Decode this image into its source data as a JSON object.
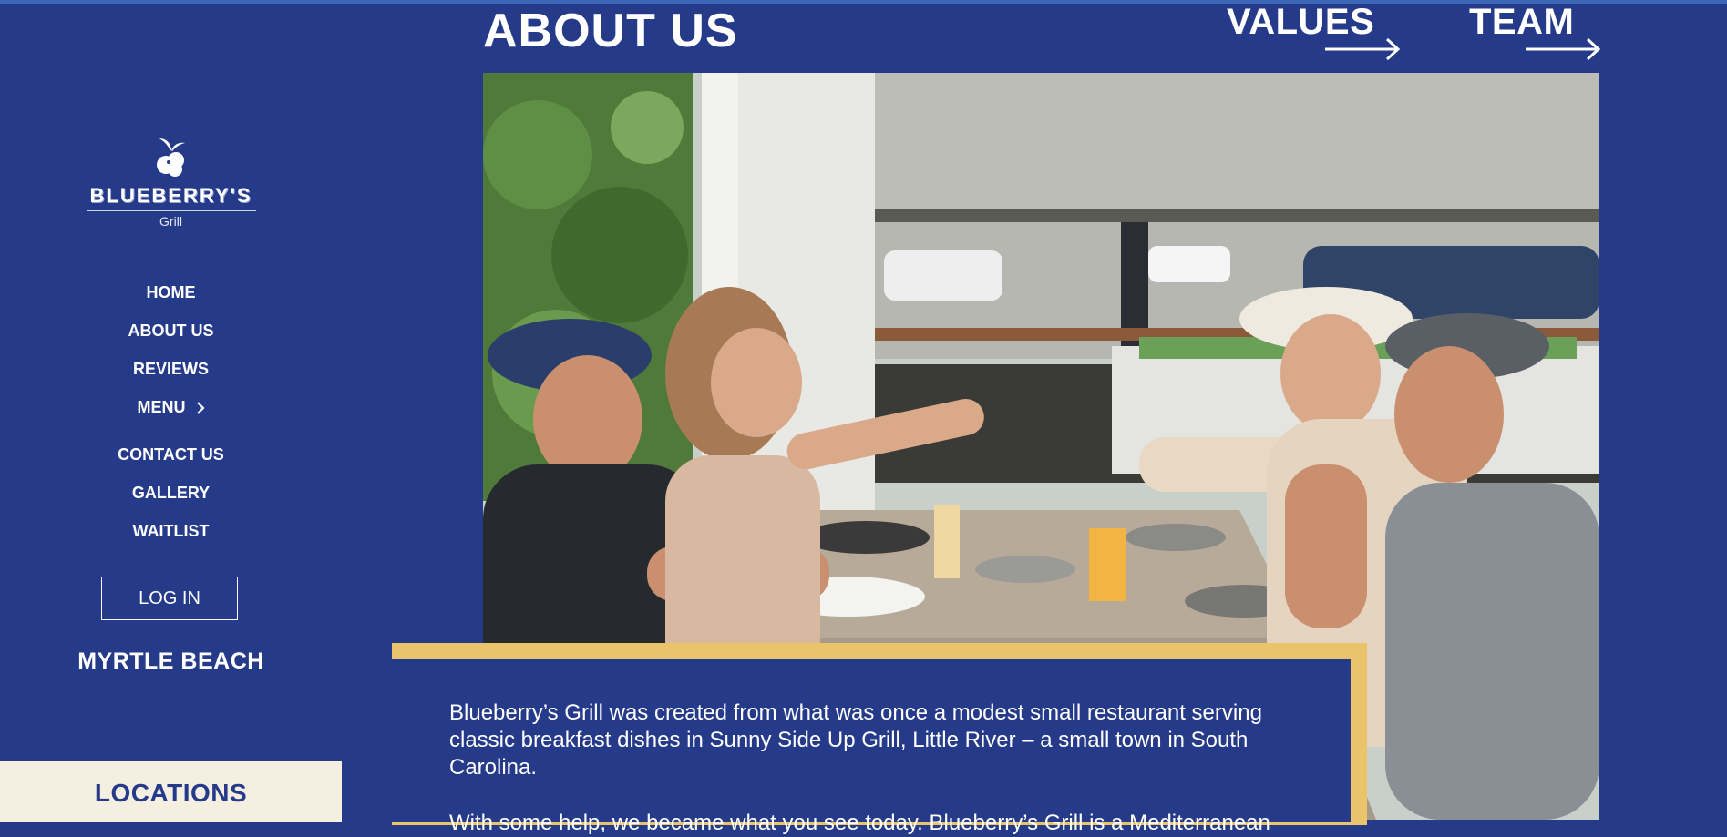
{
  "brand": {
    "name": "BLUEBERRY'S",
    "subtitle": "Grill"
  },
  "nav": {
    "items": [
      {
        "label": "HOME"
      },
      {
        "label": "ABOUT US"
      },
      {
        "label": "REVIEWS"
      },
      {
        "label": "MENU"
      },
      {
        "label": "CONTACT US"
      },
      {
        "label": "GALLERY"
      },
      {
        "label": "WAITLIST"
      }
    ],
    "login_label": "LOG IN"
  },
  "location": {
    "name": "MYRTLE BEACH"
  },
  "locations_bar": {
    "label": "LOCATIONS"
  },
  "header": {
    "title": "ABOUT US",
    "links": [
      {
        "label": "VALUES"
      },
      {
        "label": "TEAM"
      }
    ]
  },
  "about": {
    "paragraph1": "Blueberry’s Grill was created from what was once a modest small restaurant serving classic breakfast dishes in Sunny Side Up Grill, Little River – a small town in South Carolina.",
    "paragraph2": "With some help, we became what you see today. Blueberry’s Grill is a Mediterranean"
  },
  "colors": {
    "background": "#263a8a",
    "accent_gold": "#e9c46a",
    "locations_bar_bg": "#f5efe2",
    "text": "#ffffff"
  },
  "icons": [
    "blueberry-logo-icon",
    "chevron-right-icon",
    "arrow-right-icon"
  ]
}
